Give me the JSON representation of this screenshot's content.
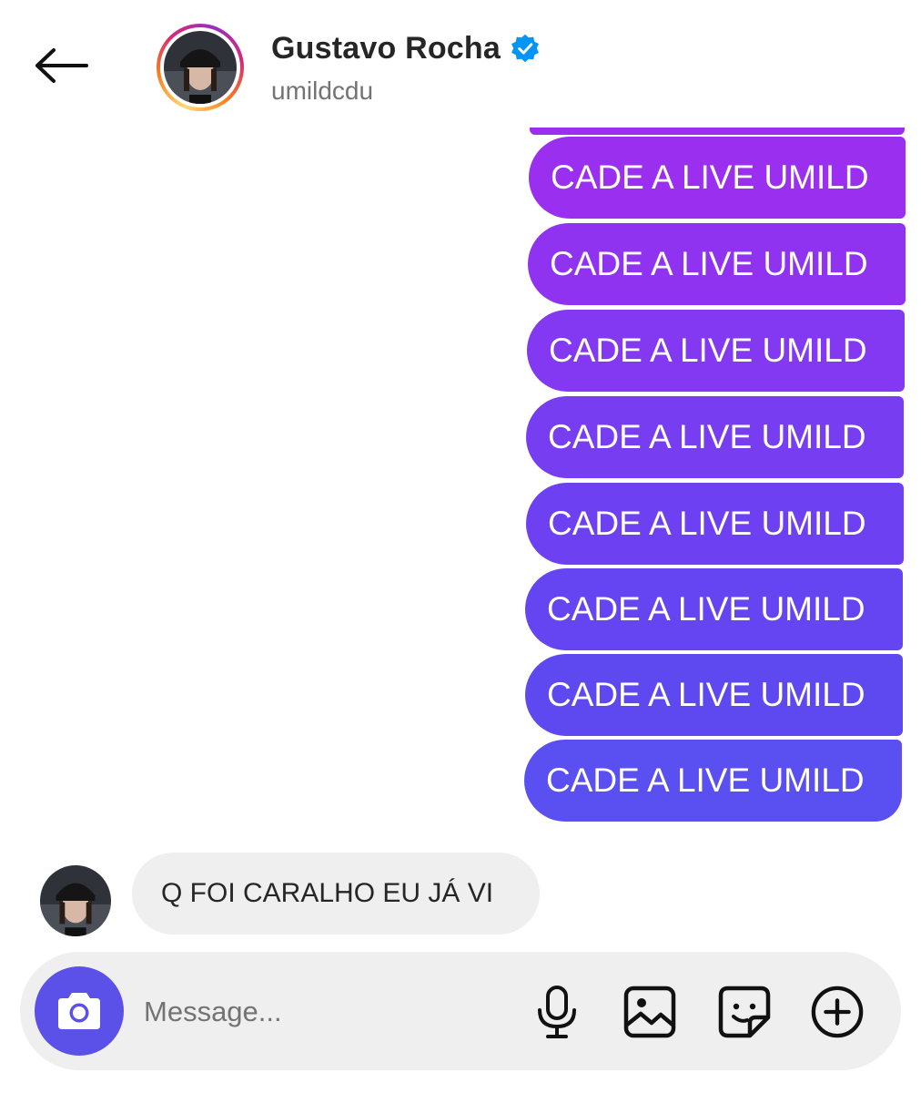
{
  "header": {
    "name": "Gustavo Rocha",
    "handle": "umildcdu",
    "verified": true,
    "icons": {
      "back": "arrow-left-icon",
      "verified": "verified-badge-icon"
    }
  },
  "messages": {
    "outgoing": [
      "CADE A LIVE UMILD",
      "CADE A LIVE UMILD",
      "CADE A LIVE UMILD",
      "CADE A LIVE UMILD",
      "CADE A LIVE UMILD",
      "CADE A LIVE UMILD",
      "CADE A LIVE UMILD",
      "CADE A LIVE UMILD"
    ],
    "incoming": "Q FOI CARALHO EU JÁ VI"
  },
  "composer": {
    "placeholder": "Message...",
    "icons": [
      "camera-icon",
      "microphone-icon",
      "gallery-icon",
      "sticker-icon",
      "plus-circle-icon"
    ]
  },
  "colors": {
    "bubble_top": "#9b2ff0",
    "bubble_bottom": "#5a4ff0",
    "camera_button": "#5b51e8",
    "incoming_bubble": "#efefef",
    "verified_badge": "#0095f6"
  }
}
